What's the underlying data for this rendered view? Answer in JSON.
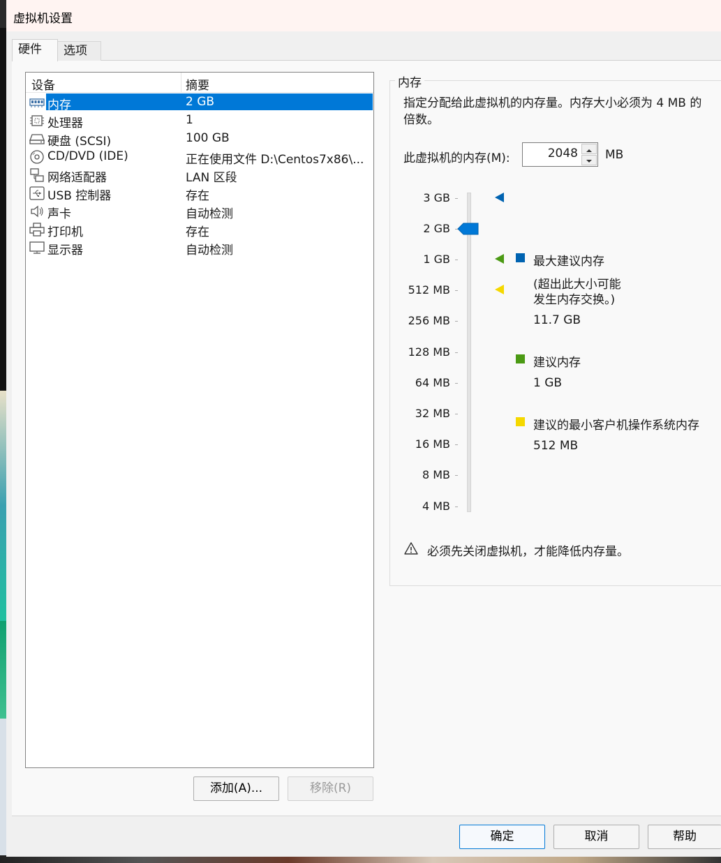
{
  "window": {
    "title": "虚拟机设置"
  },
  "tabs": [
    {
      "label": "硬件"
    },
    {
      "label": "选项"
    }
  ],
  "device_list": {
    "header": {
      "device": "设备",
      "summary": "摘要"
    },
    "items": [
      {
        "icon": "memory-icon",
        "name": "内存",
        "summary": "2 GB",
        "selected": true
      },
      {
        "icon": "processor-icon",
        "name": "处理器",
        "summary": "1"
      },
      {
        "icon": "hard-disk-icon",
        "name": "硬盘 (SCSI)",
        "summary": "100 GB"
      },
      {
        "icon": "cd-dvd-icon",
        "name": "CD/DVD (IDE)",
        "summary": "正在使用文件 D:\\Centos7x86\\..."
      },
      {
        "icon": "network-adapter-icon",
        "name": "网络适配器",
        "summary": "LAN 区段"
      },
      {
        "icon": "usb-icon",
        "name": "USB 控制器",
        "summary": "存在"
      },
      {
        "icon": "sound-card-icon",
        "name": "声卡",
        "summary": "自动检测"
      },
      {
        "icon": "printer-icon",
        "name": "打印机",
        "summary": "存在"
      },
      {
        "icon": "display-icon",
        "name": "显示器",
        "summary": "自动检测"
      }
    ],
    "add_label": "添加(A)...",
    "remove_label": "移除(R)"
  },
  "memory": {
    "group_title": "内存",
    "description": "指定分配给此虚拟机的内存量。内存大小必须为 4 MB 的倍数。",
    "field_label": "此虚拟机的内存(M):",
    "value": "2048",
    "unit": "MB",
    "scale": [
      "3 GB",
      "2 GB",
      "1 GB",
      "512 MB",
      "256 MB",
      "128 MB",
      "64 MB",
      "32 MB",
      "16 MB",
      "8 MB",
      "4 MB"
    ],
    "slider_value": "2 GB",
    "legend": {
      "max": {
        "label": "最大建议内存",
        "note": "(超出此大小可能发生生内存交换。)",
        "note_line1": "(超出此大小可能",
        "note_line2": "发生内存交换。)",
        "value": "11.7 GB",
        "color": "#0063b1"
      },
      "recommended": {
        "label": "建议内存",
        "value": "1 GB",
        "color": "#4b9a14"
      },
      "min_guest": {
        "label": "建议的最小客户机操作系统内存",
        "value": "512 MB",
        "color": "#f5d800"
      }
    },
    "warning": "必须先关闭虚拟机，才能降低内存量。"
  },
  "footer": {
    "ok_label": "确定",
    "cancel_label": "取消",
    "help_label": "帮助"
  },
  "colors": {
    "selection": "#0078d7",
    "max_marker": "#0063b1",
    "recommended_marker": "#4b9a14",
    "min_marker": "#f5d800"
  }
}
